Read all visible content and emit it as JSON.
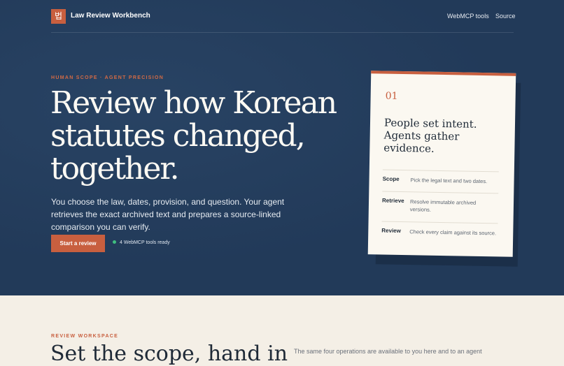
{
  "nav": {
    "logo_glyph": "법",
    "brand": "Law Review Workbench",
    "links": [
      "WebMCP tools",
      "Source"
    ]
  },
  "hero": {
    "eyebrow": "HUMAN SCOPE · AGENT PRECISION",
    "headline": "Review how Korean statutes changed, together.",
    "lede": "You choose the law, dates, provision, and question. Your agent retrieves the exact archived text and prepares a source-linked comparison you can verify.",
    "cta_label": "Start a review",
    "status": "4 WebMCP tools ready"
  },
  "card": {
    "number": "01",
    "title": "People set intent. Agents gather evidence.",
    "rows": [
      {
        "term": "Scope",
        "desc": "Pick the legal text and two dates."
      },
      {
        "term": "Retrieve",
        "desc": "Resolve immutable archived versions."
      },
      {
        "term": "Review",
        "desc": "Check every claim against its source."
      }
    ]
  },
  "workspace": {
    "eyebrow": "REVIEW WORKSPACE",
    "title": "Set the scope, hand in",
    "note": "The same four operations are available to you here and to an agent"
  },
  "colors": {
    "hero_bg": "#223a59",
    "accent": "#c85f3f",
    "page_bg": "#f4efe6",
    "status_ok": "#3fbf7f"
  }
}
